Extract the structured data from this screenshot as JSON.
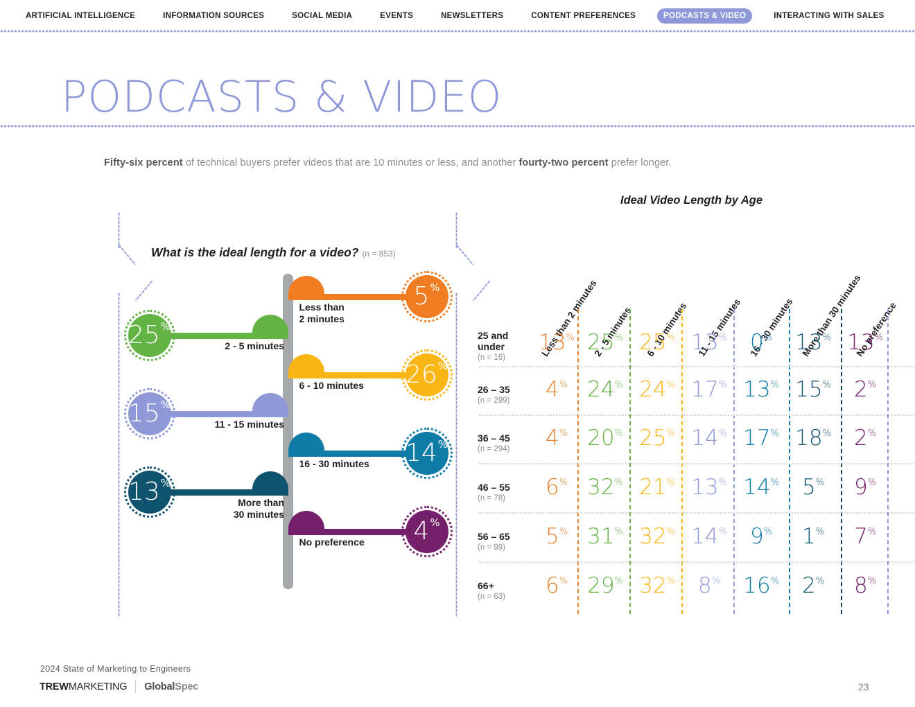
{
  "nav": {
    "items": [
      {
        "label": "ARTIFICIAL INTELLIGENCE",
        "active": false
      },
      {
        "label": "INFORMATION SOURCES",
        "active": false
      },
      {
        "label": "SOCIAL MEDIA",
        "active": false
      },
      {
        "label": "EVENTS",
        "active": false
      },
      {
        "label": "NEWSLETTERS",
        "active": false
      },
      {
        "label": "CONTENT PREFERENCES",
        "active": false
      },
      {
        "label": "PODCASTS & VIDEO",
        "active": true
      },
      {
        "label": "INTERACTING WITH SALES",
        "active": false
      }
    ],
    "active_pill_color": "#8f99da"
  },
  "header": {
    "title": "PODCASTS & VIDEO",
    "title_color": "#8f99da"
  },
  "intro": {
    "bold_1": "Fifty-six percent",
    "mid": " of technical buyers prefer videos that are 10 minutes or less, and another ",
    "bold_2": "fourty-two percent",
    "tail": " prefer longer."
  },
  "left_chart": {
    "title": "What is the ideal length for a video?",
    "sample": "(n = 853)",
    "chart_data": {
      "type": "bar",
      "title": "What is the ideal length for a video?",
      "sample": "(n = 853)",
      "xlabel": "",
      "ylabel": "",
      "categories": [
        "Less than 2 minutes",
        "2 - 5 minutes",
        "6 - 10 minutes",
        "11 - 15 minutes",
        "16 - 30 minutes",
        "More than 30 minutes",
        "No preference"
      ],
      "values": [
        5,
        25,
        26,
        15,
        14,
        13,
        4
      ],
      "unit": "%",
      "colors": [
        "#f07d22",
        "#63b345",
        "#fbb515",
        "#9099d8",
        "#0f7ba7",
        "#10536f",
        "#75206a"
      ],
      "sides": [
        "right",
        "left",
        "right",
        "left",
        "right",
        "left",
        "right"
      ]
    }
  },
  "right_chart": {
    "title": "Ideal Video Length by Age",
    "chart_data": {
      "type": "table",
      "title": "Ideal Video Length by Age",
      "columns": [
        "Less than 2 minutes",
        "2 - 5 minutes",
        "6 - 10 minutes",
        "11 - 15 minutes",
        "16 - 30 minutes",
        "More than 30 minutes",
        "No preference"
      ],
      "column_colors": [
        "#e8812a",
        "#63b345",
        "#fbb515",
        "#9099d8",
        "#0f7ba7",
        "#10536f",
        "#75206a"
      ],
      "divider_colors": [
        "#e8812a",
        "#6fae4b",
        "#fbb515",
        "#9099d8",
        "#0f7ba7",
        "#163f5c",
        "#9099d8"
      ],
      "unit": "%",
      "rows": [
        {
          "age": "25 and under",
          "n": "(n = 16)",
          "values": [
            13,
            25,
            25,
            13,
            0,
            13,
            13
          ]
        },
        {
          "age": "26 – 35",
          "n": "(n = 299)",
          "values": [
            4,
            24,
            24,
            17,
            13,
            15,
            2
          ]
        },
        {
          "age": "36 – 45",
          "n": "(n = 294)",
          "values": [
            4,
            20,
            25,
            14,
            17,
            18,
            2
          ]
        },
        {
          "age": "46 – 55",
          "n": "(n = 78)",
          "values": [
            6,
            32,
            21,
            13,
            14,
            5,
            9
          ]
        },
        {
          "age": "56 – 65",
          "n": "(n = 99)",
          "values": [
            5,
            31,
            32,
            14,
            9,
            1,
            7
          ]
        },
        {
          "age": "66+",
          "n": "(n = 63)",
          "values": [
            6,
            29,
            32,
            8,
            16,
            2,
            8
          ]
        }
      ]
    }
  },
  "footer": {
    "report": "2024 State of Marketing to Engineers",
    "logo_trew_bold": "TREW",
    "logo_trew_light": "MARKETING",
    "logo_globalspec_a": "Global",
    "logo_globalspec_b": "Spec",
    "page_number": "23"
  }
}
